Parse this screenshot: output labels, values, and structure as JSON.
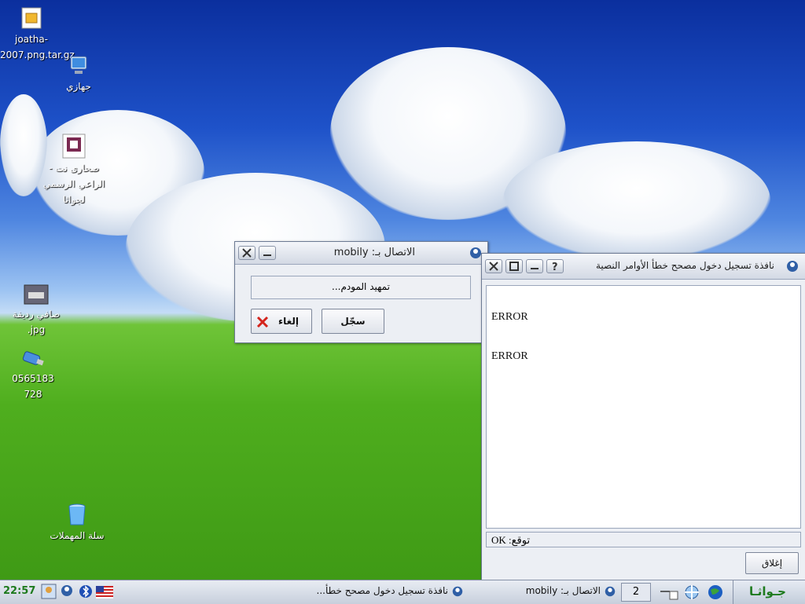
{
  "desktop": {
    "icons": [
      {
        "label": "joatha-2007.png.tar.gz"
      },
      {
        "label": "جهازي"
      },
      {
        "label": "صحارى نت - الراعي الرسمي لجواثا"
      },
      {
        "label": "صافي رديفة .jpg"
      },
      {
        "label": "0565183728"
      },
      {
        "label": "سلة المهملات"
      }
    ]
  },
  "dialog": {
    "title": "الاتصال بـ: mobily",
    "status": "تمهيد المودم...",
    "cancel_label": "إلغاء",
    "log_label": "سجّل"
  },
  "log_window": {
    "title": "نافذة تسجيل دخول مصحح خطأ الأوامر النصية",
    "lines": [
      "ERROR",
      "ERROR"
    ],
    "expect_label": "توقع: OK",
    "close_label": "إغلاق"
  },
  "taskbar": {
    "clock": "22:57",
    "task1": "نافذة تسجيل دخول مصحح خطأ...",
    "task2": "الاتصال بـ: mobily",
    "desktop_number": "2",
    "menu_label": "جـواثـا"
  },
  "colors": {
    "sky_top": "#0b2f9e",
    "grass": "#4fae1e",
    "clock_green": "#1d7a1d",
    "cancel_red": "#d4241c"
  }
}
